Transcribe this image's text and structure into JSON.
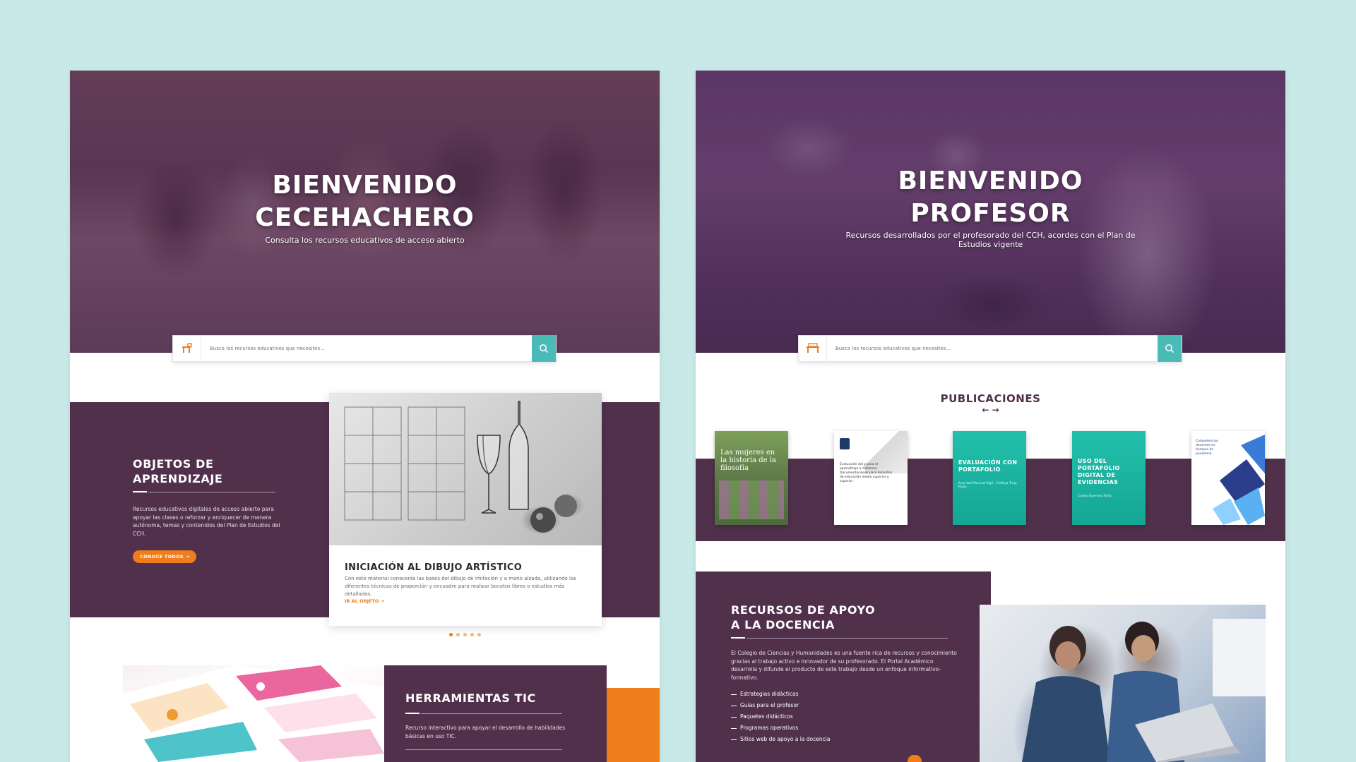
{
  "left": {
    "hero": {
      "title_line1": "BIENVENIDO",
      "title_line2": "CECEHACHERO",
      "subtitle": "Consulta los recursos educativos de acceso abierto"
    },
    "search": {
      "placeholder": "Busca los recursos educativos que necesites..."
    },
    "objetos": {
      "title_line1": "OBJETOS DE",
      "title_line2": "APRENDIZAJE",
      "description": "Recursos educativos digitales de acceso abierto para apoyar las clases o reforzar y enriquecer de manera autónoma, temas y contenidos del Plan de Estudios del CCH.",
      "button_label": "CONOCE TODOS →"
    },
    "card": {
      "title": "INICIACIÓN AL DIBUJO ARTÍSTICO",
      "description": "Con este material conocerás las bases del dibujo de imitación y a mano alzada, utilizando las diferentes técnicas de proporción y encuadre para realizar bocetos libres o estudios más detallados.",
      "link_label": "IR AL OBJETO →"
    },
    "carousel": {
      "total_dots": 5,
      "active_index": 0
    },
    "tic": {
      "title": "HERRAMIENTAS TIC",
      "description": "Recurso interactivo para apoyar el desarrollo de habilidades básicas en uso TIC."
    }
  },
  "right": {
    "hero": {
      "title_line1": "BIENVENIDO",
      "title_line2": "PROFESOR",
      "subtitle": "Recursos desarrollados por el profesorado del CCH, acordes con el Plan de Estudios vigente"
    },
    "search": {
      "placeholder": "Busca los recursos educativos que necesites..."
    },
    "publicaciones": {
      "title": "PUBLICACIONES",
      "arrows": "← →",
      "books": [
        {
          "title": "Las mujeres en la historia de la filosofía",
          "color": "#6b8f3e"
        },
        {
          "title": "Evaluación del y para el aprendizaje a distancia: Documentaciones para docentes de educación media superior y superior",
          "color": "#ffffff"
        },
        {
          "title": "EVALUACIÓN CON PORTAFOLIO",
          "author": "Ana Itzel Pascual Vigil · Cinthya Trejo Rojas",
          "color": "#1bb8a8"
        },
        {
          "title": "USO DEL PORTAFOLIO DIGITAL DE EVIDENCIAS",
          "author": "Carlos Guerrero Ávila",
          "color": "#1bb8a8"
        },
        {
          "title": "Competencias docentes en tiempos de pandemia",
          "color": "#ffffff"
        }
      ]
    },
    "recursos": {
      "title_line1": "RECURSOS DE APOYO",
      "title_line2": "A LA DOCENCIA",
      "description": "El Colegio de Ciencias y Humanidades es una fuente rica de recursos y conocimiento gracias al trabajo activo e innovador de su profesorado. El Portal Académico desarrolla y difunde el producto de este trabajo desde un enfoque informativo-formativo.",
      "items": [
        "Estrategias didácticas",
        "Guías para el profesor",
        "Paquetes didácticos",
        "Programas operativos",
        "Sitios web de apoyo a la docencia"
      ]
    }
  },
  "colors": {
    "background": "#c8e9e7",
    "plum": "#51304c",
    "orange": "#ef7d1a",
    "teal": "#4bbbb8"
  }
}
